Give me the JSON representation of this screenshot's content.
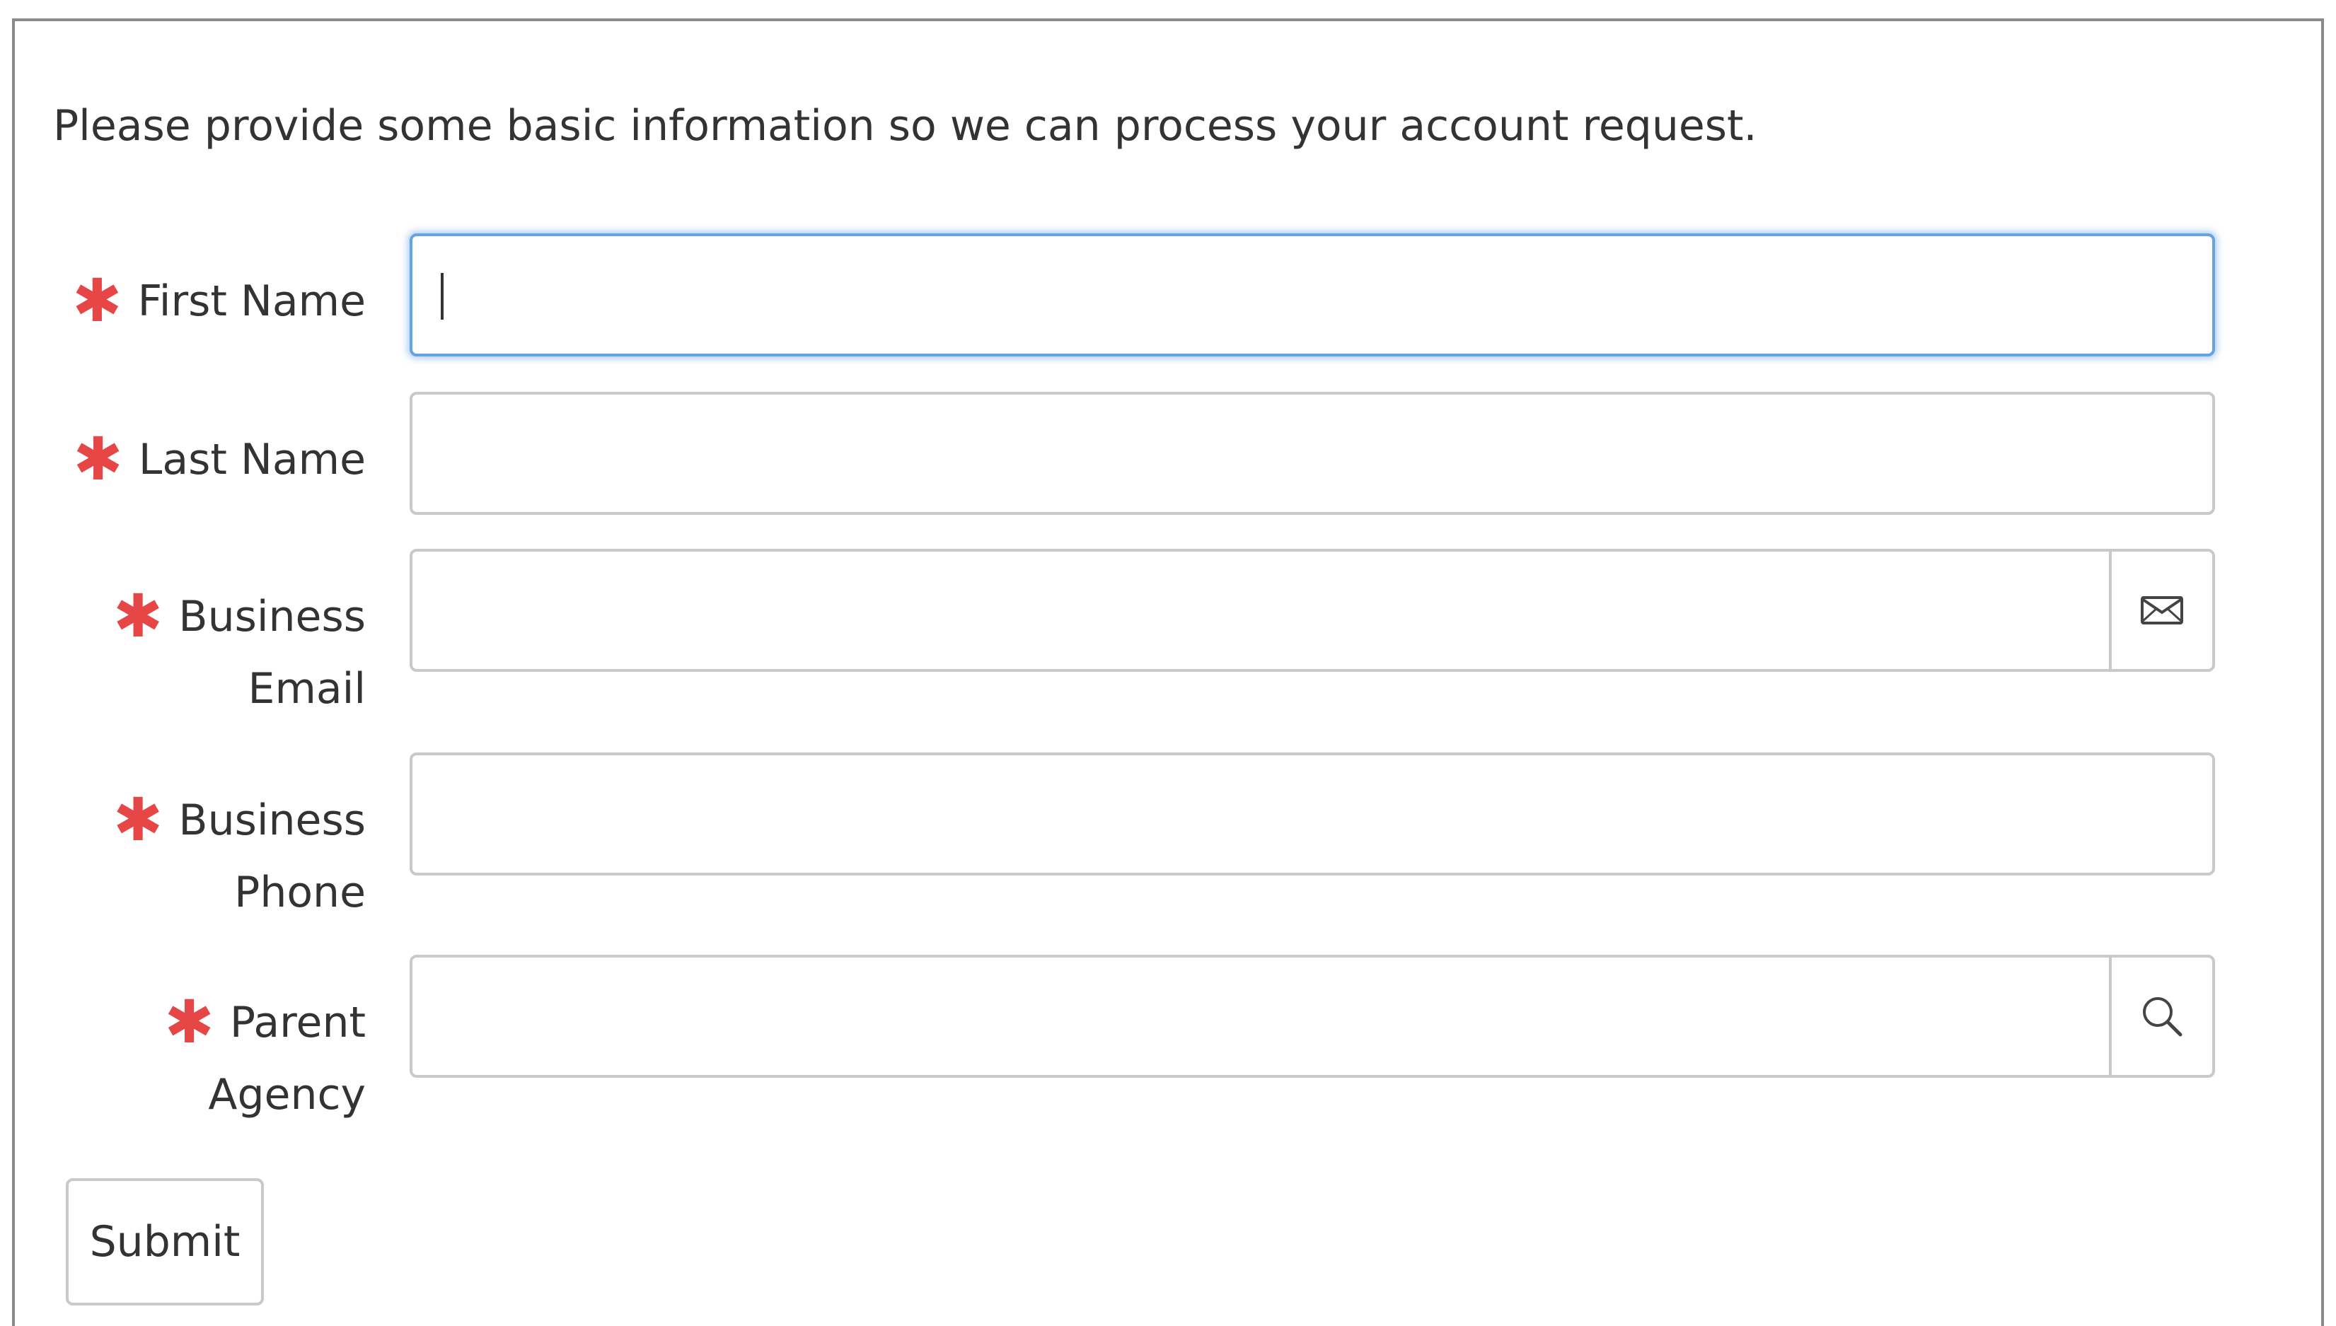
{
  "intro_text": "Please provide some basic information so we can process your account request.",
  "required_marker": "✱",
  "form": {
    "first_name": {
      "label": "First Name",
      "value": "",
      "focused": true
    },
    "last_name": {
      "label": "Last Name",
      "value": ""
    },
    "business_email": {
      "label_line1": "Business",
      "label_line2": "Email",
      "value": "",
      "addon_icon": "envelope-icon"
    },
    "business_phone": {
      "label_line1": "Business",
      "label_line2": "Phone",
      "value": ""
    },
    "parent_agency": {
      "label_line1": "Parent",
      "label_line2": "Agency",
      "value": "",
      "addon_icon": "search-icon"
    }
  },
  "submit_label": "Submit",
  "colors": {
    "required": "#e64646",
    "focus_border": "#66a3e0",
    "border": "#c9c9c9",
    "text": "#333333"
  }
}
